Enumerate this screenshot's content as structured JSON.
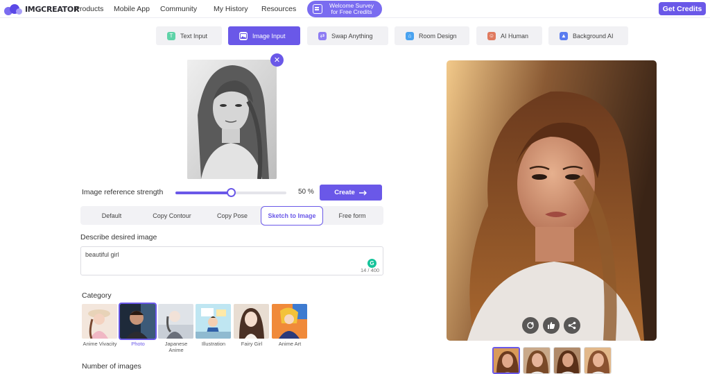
{
  "nav": {
    "logo_text": "IMGCREATOR",
    "links": [
      "Products",
      "Mobile App",
      "Community",
      "My History",
      "Resources"
    ],
    "survey_line1": "Welcome Survey",
    "survey_line2": "for Free Credits",
    "get_credits": "Get Credits"
  },
  "mode_tabs": [
    "Text Input",
    "Image Input",
    "Swap Anything",
    "Room Design",
    "AI Human",
    "Background AI"
  ],
  "active_tab": "Image Input",
  "strength": {
    "label": "Image reference strength",
    "value_text": "50 %",
    "value": 0.5
  },
  "create_label": "Create",
  "modes": [
    "Default",
    "Copy Contour",
    "Copy Pose",
    "Sketch to Image",
    "Free form"
  ],
  "active_mode": "Sketch to Image",
  "describe": {
    "label": "Describe desired image",
    "value": "beautiful girl",
    "counter": "14 / 400"
  },
  "category": {
    "label": "Category",
    "items": [
      "Anime Vivacity",
      "Photo",
      "Japanese Anime",
      "Illustration",
      "Fairy Girl",
      "Anime Art"
    ],
    "selected": "Photo"
  },
  "number_of_images_label": "Number of images",
  "colors": {
    "accent": "#6a58e8",
    "survey": "#7a6cf0",
    "grammarly": "#15c39a"
  }
}
